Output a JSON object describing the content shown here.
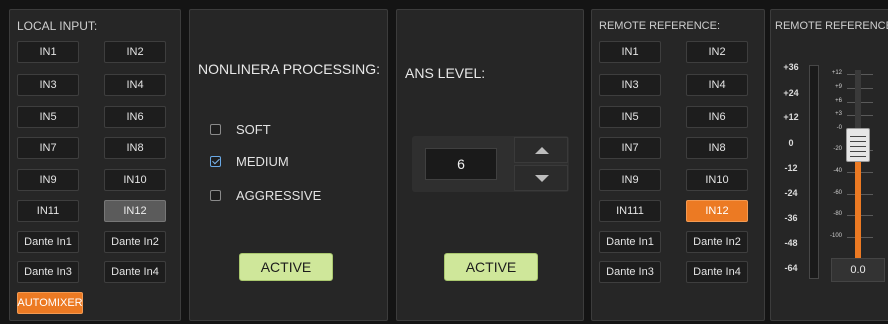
{
  "local_input": {
    "title": "LOCAL INPUT:",
    "buttons": [
      "IN1",
      "IN2",
      "IN3",
      "IN4",
      "IN5",
      "IN6",
      "IN7",
      "IN8",
      "IN9",
      "IN10",
      "IN11",
      "IN12",
      "Dante In1",
      "Dante In2",
      "Dante In3",
      "Dante In4"
    ],
    "automixer": "AUTOMIXER"
  },
  "nonlinear": {
    "title": "NONLINERA PROCESSING:",
    "options": [
      "SOFT",
      "MEDIUM",
      "AGGRESSIVE"
    ],
    "selected": "MEDIUM",
    "active": "ACTIVE"
  },
  "ans": {
    "title": "ANS LEVEL:",
    "value": "6",
    "active": "ACTIVE"
  },
  "remote_ref": {
    "title": "REMOTE REFERENCE:",
    "buttons": [
      "IN1",
      "IN2",
      "IN3",
      "IN4",
      "IN5",
      "IN6",
      "IN7",
      "IN8",
      "IN9",
      "IN10",
      "IN111",
      "IN12",
      "Dante In1",
      "Dante In2",
      "Dante In3",
      "Dante In4"
    ]
  },
  "meter": {
    "title": "REMOTE REFERENCE",
    "scale": [
      "+36",
      "+24",
      "+12",
      "0",
      "-12",
      "-24",
      "-36",
      "-48",
      "-64"
    ],
    "fader_scale": [
      "+12",
      "+9",
      "+6",
      "+3",
      "-0",
      "-20",
      "-40",
      "-60",
      "-80",
      "-100"
    ],
    "readout": "0.0"
  },
  "colors": {
    "accent_orange": "#ec7a23",
    "active_green": "#cfe79a",
    "selected_grey": "#5b5b5b"
  }
}
